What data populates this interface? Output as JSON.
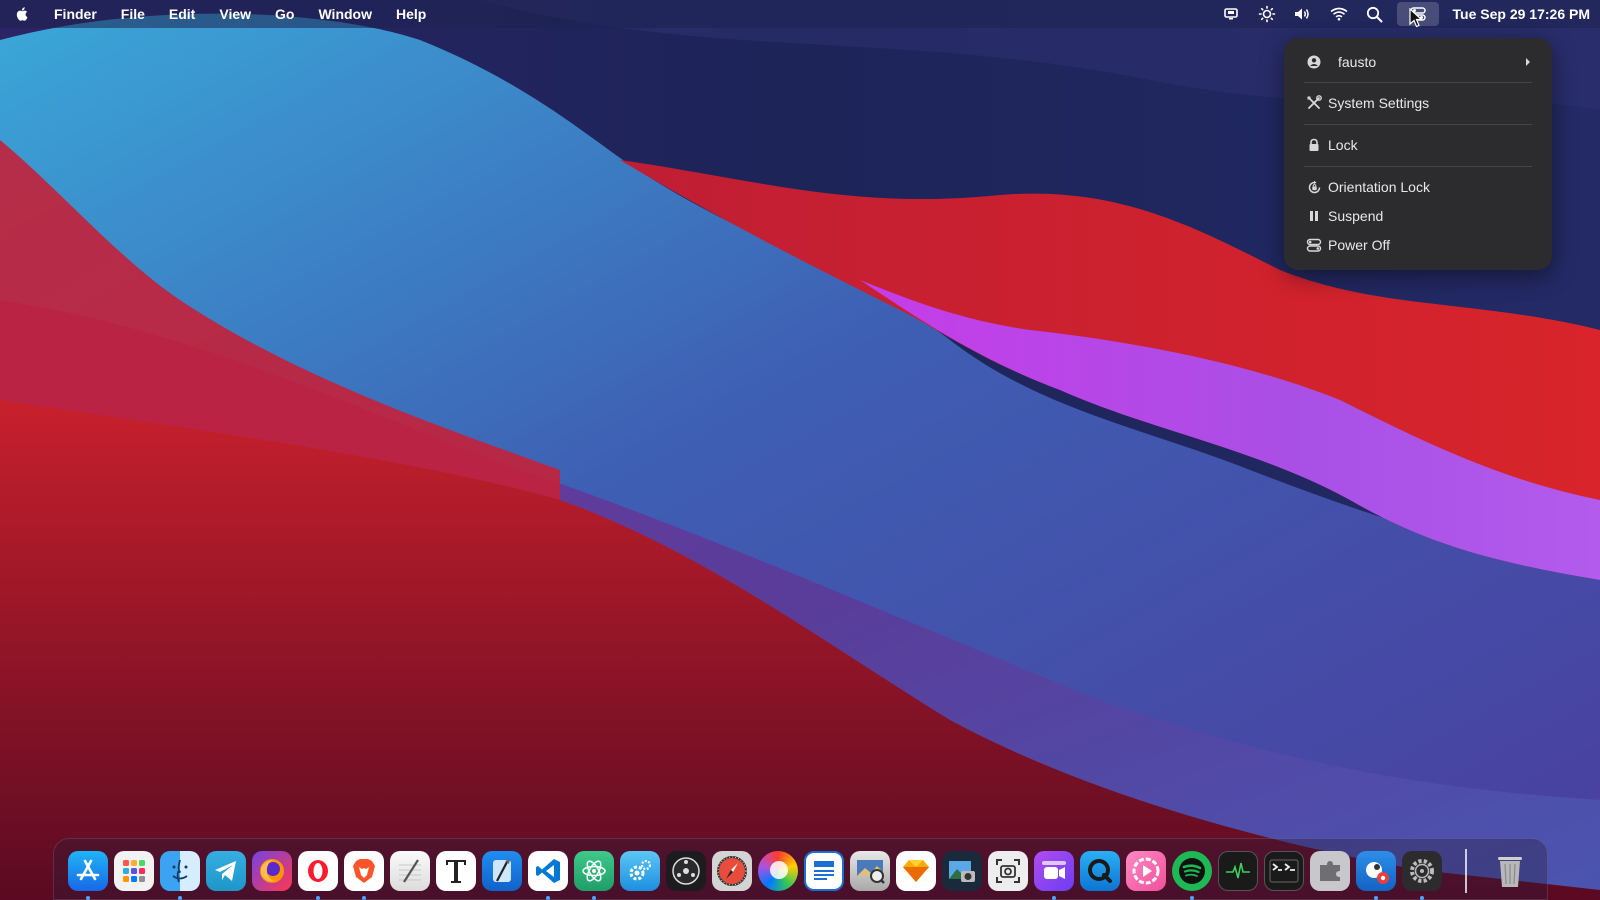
{
  "menubar": {
    "menus": [
      "Finder",
      "File",
      "Edit",
      "View",
      "Go",
      "Window",
      "Help"
    ],
    "status_icons": [
      "screencast-icon",
      "brightness-icon",
      "volume-icon",
      "wifi-icon",
      "search-icon",
      "system-menu-icon"
    ],
    "clock": "Tue Sep 29  17:26 PM"
  },
  "system_menu": {
    "user": "fausto",
    "items": {
      "settings": "System Settings",
      "lock": "Lock",
      "orientation": "Orientation Lock",
      "suspend": "Suspend",
      "poweroff": "Power Off"
    }
  },
  "dock": {
    "apps": [
      {
        "name": "app-store",
        "running": true
      },
      {
        "name": "launchpad",
        "running": false
      },
      {
        "name": "finder",
        "running": true
      },
      {
        "name": "telegram",
        "running": false
      },
      {
        "name": "firefox",
        "running": false
      },
      {
        "name": "opera",
        "running": true
      },
      {
        "name": "brave",
        "running": true
      },
      {
        "name": "text-editor",
        "running": false
      },
      {
        "name": "typora",
        "running": false
      },
      {
        "name": "xcode",
        "running": false
      },
      {
        "name": "vscode",
        "running": true
      },
      {
        "name": "atom",
        "running": true
      },
      {
        "name": "preferences",
        "running": false
      },
      {
        "name": "disk-utility",
        "running": false
      },
      {
        "name": "browser",
        "running": true
      },
      {
        "name": "color-picker",
        "running": false
      },
      {
        "name": "document-viewer",
        "running": false
      },
      {
        "name": "image-viewer",
        "running": false
      },
      {
        "name": "sketch",
        "running": false
      },
      {
        "name": "photo-app",
        "running": false
      },
      {
        "name": "screenshot",
        "running": false
      },
      {
        "name": "video-recorder",
        "running": true
      },
      {
        "name": "quicktime",
        "running": false
      },
      {
        "name": "media-player",
        "running": false
      },
      {
        "name": "spotify",
        "running": true
      },
      {
        "name": "activity-monitor",
        "running": false
      },
      {
        "name": "terminal",
        "running": false
      },
      {
        "name": "plugin-manager",
        "running": false
      },
      {
        "name": "gimp",
        "running": true
      },
      {
        "name": "system-preferences",
        "running": true
      },
      {
        "name": "trash",
        "running": false
      }
    ]
  },
  "colors": {
    "menu_bg": "#2c2c2e",
    "accent_dot": "#4fa3ff"
  }
}
